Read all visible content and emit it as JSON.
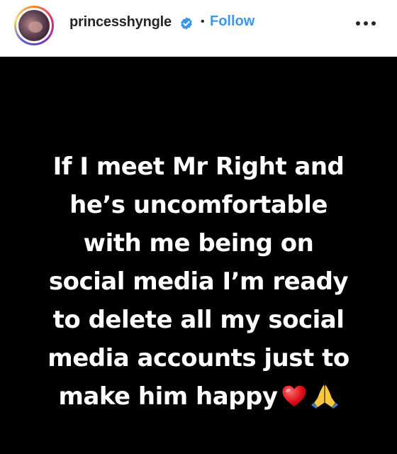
{
  "header": {
    "username": "princesshyngle",
    "separator": "•",
    "follow_label": "Follow",
    "avatar_icon": "profile-photo",
    "verified_icon": "verified-badge-icon",
    "more_icon": "more-options-icon"
  },
  "post": {
    "background_color": "#000000",
    "text_color": "#ffffff",
    "lines": [
      "If I meet Mr Right and",
      "he’s uncomfortable",
      "with me being on",
      "social media I’m ready",
      "to delete all my social",
      "media accounts just to",
      "make him happy"
    ],
    "emojis": [
      "red-heart-icon",
      "folded-hands-icon"
    ]
  },
  "colors": {
    "follow": "#3897f0",
    "verified": "#3897f0",
    "username": "#262626"
  }
}
